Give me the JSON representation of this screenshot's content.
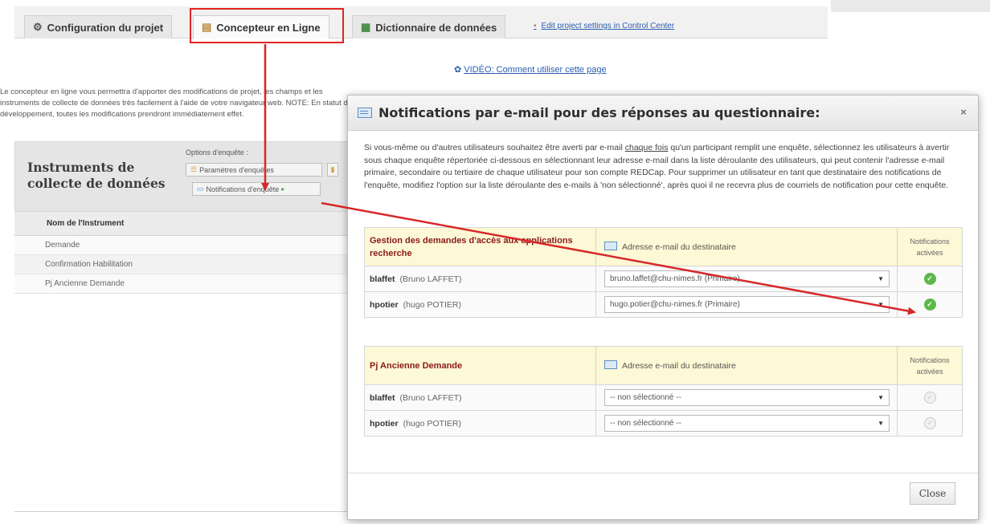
{
  "tabs": [
    {
      "label": "Configuration du projet",
      "icon": "gear-icon"
    },
    {
      "label": "Concepteur en Ligne",
      "icon": "clipboard-icon"
    },
    {
      "label": "Dictionnaire de données",
      "icon": "spreadsheet-icon"
    }
  ],
  "tab_link": "Edit project settings in Control Center",
  "video_link": "VIDÉO: Comment utiliser cette page",
  "intro_text": "Le concepteur en ligne vous permettra d'apporter des modifications de projet, les champs et les instruments de collecte de données très facilement à l'aide de votre navigateur web. NOTE: En statut de développement, toutes les modifications prendront immédiatement effet.",
  "panel": {
    "title": "Instruments de collecte de données",
    "options_label": "Options d'enquête :",
    "btn_settings": "Paramètres d'enquêtes",
    "btn_notifications": "Notifications d'enquête"
  },
  "instruments": {
    "header": "Nom de l'Instrument",
    "rows": [
      "Demande",
      "Confirmation Habilitation",
      "Pj Ancienne Demande"
    ]
  },
  "dialog": {
    "title": "Notifications par e-mail pour des réponses au questionnaire:",
    "close_x": "×",
    "desc_before": "Si vous-même ou d'autres utilisateurs souhaitez être averti par e-mail ",
    "desc_underline": "chaque fois",
    "desc_after": " qu'un participant remplit une enquête, sélectionnez les utilisateurs à avertir sous chaque enquête répertoriée ci-dessous en sélectionnant leur adresse e-mail dans la liste déroulante des utilisateurs, qui peut contenir l'adresse e-mail primaire, secondaire ou tertiaire de chaque utilisateur pour son compte REDCap. Pour supprimer un utilisateur en tant que destinataire des notifications de l'enquête, modifiez l'option sur la liste déroulante des e-mails à 'non sélectionné', après quoi il ne recevra plus de courriels de notification pour cette enquête.",
    "close_button": "Close",
    "tables": [
      {
        "title": "Gestion des demandes d'accès aux applications recherche",
        "addr_header": "Adresse e-mail du destinataire",
        "active_header": "Notifications activées",
        "rows": [
          {
            "user": "blaffet",
            "full": "(Bruno LAFFET)",
            "email": "bruno.laffet@chu-nimes.fr (Primaire)",
            "enabled": "✓"
          },
          {
            "user": "hpotier",
            "full": "(hugo POTIER)",
            "email": "hugo.potier@chu-nimes.fr (Primaire)",
            "enabled": "✓"
          }
        ]
      },
      {
        "title": "Pj Ancienne Demande",
        "addr_header": "Adresse e-mail du destinataire",
        "active_header": "Notifications activées",
        "rows": [
          {
            "user": "blaffet",
            "full": "(Bruno LAFFET)",
            "email": "-- non sélectionné --",
            "enabled": "✓"
          },
          {
            "user": "hpotier",
            "full": "(hugo POTIER)",
            "email": "-- non sélectionné --",
            "enabled": "✓"
          }
        ]
      }
    ]
  },
  "colors": {
    "highlight": "#e32323",
    "arrow": "#d62828",
    "table_title": "#8b1a1a",
    "table_header_bg": "#fdf8d5",
    "check_active": "#5db84a"
  }
}
